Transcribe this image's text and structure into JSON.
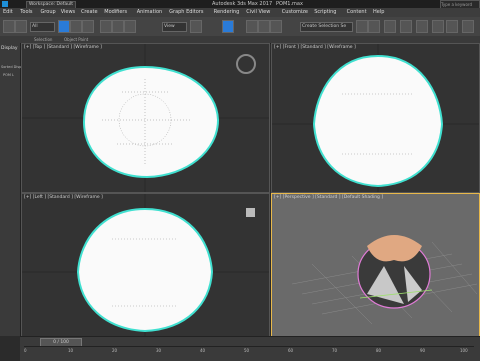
{
  "titlebar": {
    "workspace": "Workspace: Default",
    "app_title": "Autodesk 3ds Max 2017",
    "file_name": "POM1.max",
    "search_placeholder": "Type a keyword"
  },
  "menu": [
    "Edit",
    "Tools",
    "Group",
    "Views",
    "Create",
    "Modifiers",
    "Animation",
    "Graph Editors",
    "Rendering",
    "Civil View",
    "Customize",
    "Scripting",
    "Content",
    "Help"
  ],
  "toolbar": {
    "filter": "All",
    "view": "View",
    "selection_set": "Create Selection Se"
  },
  "ribbon_labels": [
    "Selection",
    "Object Paint"
  ],
  "left_panel": {
    "tab": "Display",
    "item1": "Sorted Disp",
    "item2": "POM L"
  },
  "viewports": {
    "top": "[+] [Top ] [Standard ] [Wireframe ]",
    "front": "[+] [Front ] [Standard ] [Wireframe ]",
    "left": "[+] [Left ] [Standard ] [Wireframe ]",
    "perspective": "[+] [Perspective ] [Standard ] [Default Shading ]"
  },
  "timeline": {
    "frame_counter": "0 / 100",
    "ticks": [
      "0",
      "10",
      "20",
      "30",
      "40",
      "50",
      "60",
      "70",
      "80",
      "90",
      "100"
    ]
  },
  "colors": {
    "active_border": "#e8b84a",
    "wire_cyan": "#40e0d0",
    "accent_blue": "#2a7bd8"
  }
}
